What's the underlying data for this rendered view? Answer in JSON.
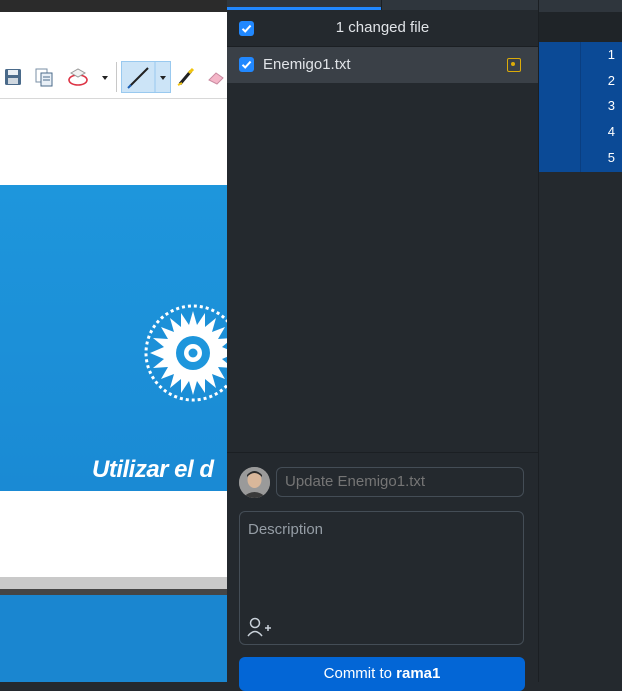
{
  "changes": {
    "header_title": "1 changed file",
    "files": [
      {
        "name": "Enemigo1.txt",
        "status": "modified",
        "checked": true
      }
    ]
  },
  "commit": {
    "summary_placeholder": "Update Enemigo1.txt",
    "description_placeholder": "Description",
    "button_prefix": "Commit to ",
    "branch": "rama1"
  },
  "document": {
    "banner_text": "Utilizar el d"
  },
  "diff": {
    "line_numbers": [
      "1",
      "2",
      "3",
      "4",
      "5"
    ]
  },
  "colors": {
    "accent": "#2188ff",
    "commit_button": "#0366d6",
    "modified": "#dbab09",
    "banner": "#1e96dc"
  }
}
